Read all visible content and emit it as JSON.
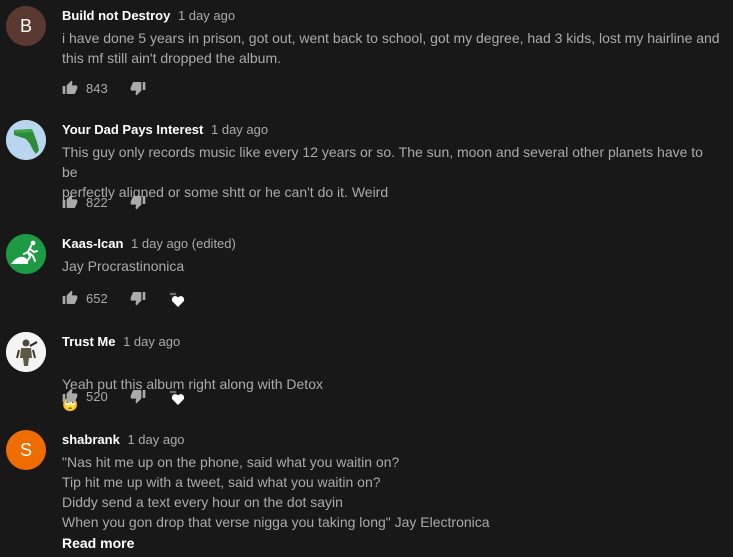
{
  "colors": {
    "background": "#181818",
    "author": "#ffffff",
    "text": "#aaaaaa",
    "avatar_b": "#5a3a30",
    "avatar_s": "#ef6c00"
  },
  "comments": [
    {
      "author": "Build not Destroy",
      "time": "1 day ago",
      "avatar_letter": "B",
      "text": "i have done 5 years in prison,  got out, went back to school, got my degree, had 3 kids, lost my hairline and\nthis mf still ain't dropped the album.",
      "likes": "843",
      "icons": [
        "thumb-up-icon",
        "thumb-down-icon"
      ]
    },
    {
      "author": "Your Dad Pays Interest",
      "time": "1 day ago",
      "avatar_letter": "",
      "text": "This guy only records music like every 12 years or so. The sun, moon and several other planets have to be\nperfectly aligned or some shtt or he can't do it. Weird",
      "likes": "822",
      "icons": [
        "thumb-up-icon",
        "thumb-down-icon"
      ]
    },
    {
      "author": "Kaas-Ican",
      "time": "1 day ago (edited)",
      "avatar_letter": "",
      "text": "Jay Procrastinonica",
      "likes": "652",
      "icons": [
        "thumb-up-icon",
        "thumb-down-icon",
        "creator-heart-icon"
      ]
    },
    {
      "author": "Trust Me",
      "time": "1 day ago",
      "avatar_letter": "",
      "text": "Yeah put this album right along with Detox",
      "emoji": "🙄",
      "likes": "520",
      "icons": [
        "thumb-up-icon",
        "thumb-down-icon",
        "creator-heart-icon"
      ]
    },
    {
      "author": "shabrank",
      "time": "1 day ago",
      "avatar_letter": "S",
      "text": "\"Nas hit me up on the phone, said what you waitin on?\nTip hit me up with a tweet, said what you waitin on?\nDiddy send a text every hour on the dot sayin\nWhen you gon drop that verse nigga you taking long\" Jay Electronica",
      "read_more": "Read more"
    }
  ]
}
